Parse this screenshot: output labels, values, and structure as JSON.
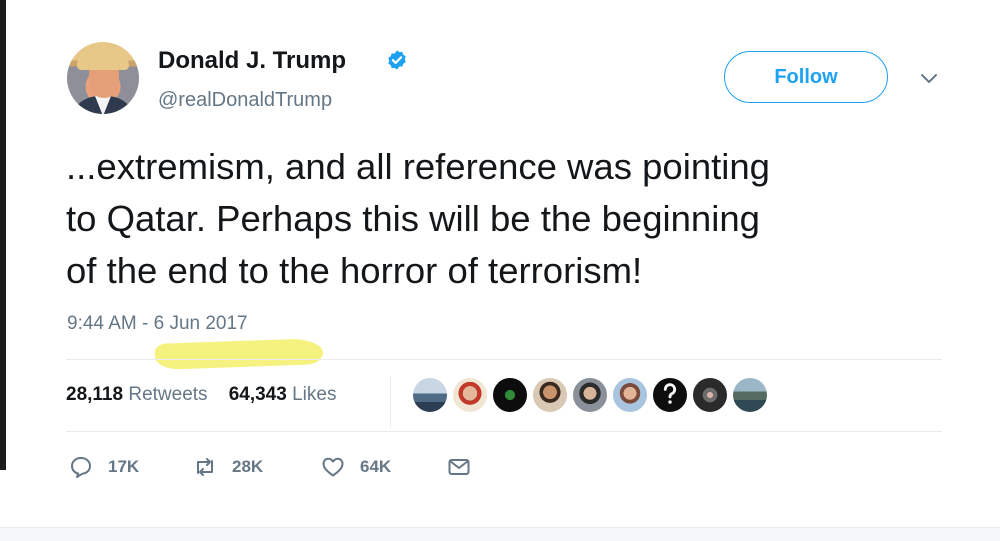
{
  "tweet": {
    "author_name": "Donald J. Trump",
    "author_handle": "@realDonaldTrump",
    "follow_label": "Follow",
    "text_lines": [
      "...extremism, and all reference was pointing",
      "to Qatar. Perhaps this will be the beginning",
      "of the end to the horror of terrorism!"
    ],
    "timestamp": "9:44 AM - 6 Jun 2017",
    "retweets_count": "28,118",
    "retweets_label": "Retweets",
    "likes_count": "64,343",
    "likes_label": "Likes",
    "actions": {
      "reply_count": "17K",
      "retweet_count": "28K",
      "like_count": "64K"
    }
  },
  "icons": {
    "verified": "verified-badge-icon",
    "more": "chevron-down-icon",
    "reply": "reply-icon",
    "retweet": "retweet-icon",
    "like": "heart-icon",
    "message": "envelope-icon"
  },
  "colors": {
    "accent": "#1da1f2",
    "secondary_text": "#657786",
    "highlight": "#f3f06a"
  }
}
